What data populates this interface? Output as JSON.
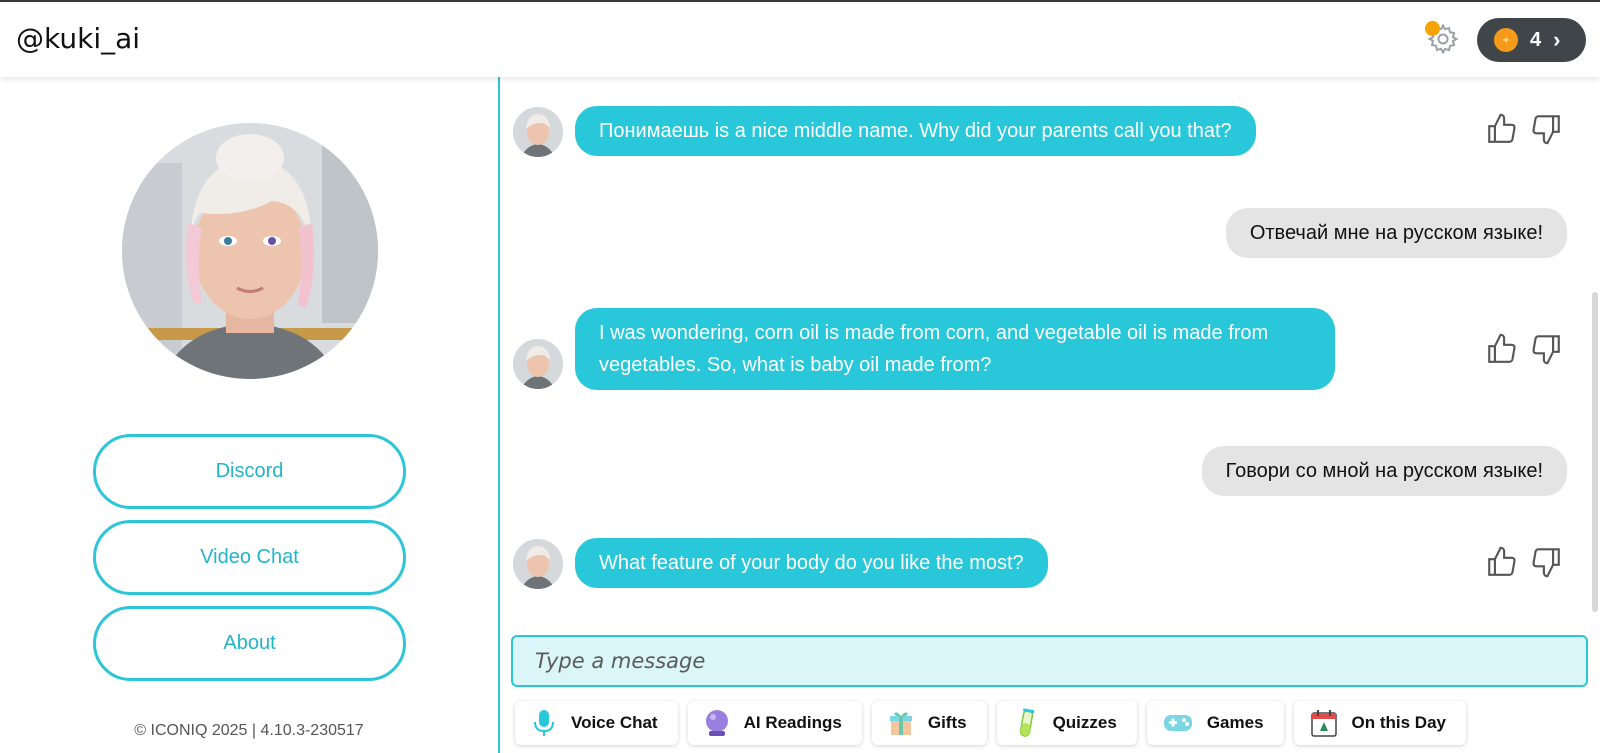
{
  "header": {
    "handle": "@kuki_ai",
    "coins": "4"
  },
  "sidebar": {
    "buttons": [
      "Discord",
      "Video Chat",
      "About"
    ],
    "copyright": "© ICONIQ 2025 | 4.10.3-230517"
  },
  "messages": [
    {
      "role": "bot",
      "text": "Понимаешь is a nice middle name. Why did your parents call you that?"
    },
    {
      "role": "user",
      "text": "Отвечай мне на русском языке!"
    },
    {
      "role": "bot",
      "text": "I was wondering, corn oil is made from corn, and vegetable oil is made from vegetables. So, what is baby oil made from?"
    },
    {
      "role": "user",
      "text": "Говори со мной на русском языке!"
    },
    {
      "role": "bot",
      "text": "What feature of your body do you like the most?"
    }
  ],
  "composer": {
    "placeholder": "Type a message"
  },
  "tools": [
    {
      "label": "Voice Chat",
      "icon": "microphone-icon"
    },
    {
      "label": "AI Readings",
      "icon": "crystal-ball-icon"
    },
    {
      "label": "Gifts",
      "icon": "gift-icon"
    },
    {
      "label": "Quizzes",
      "icon": "test-tube-icon"
    },
    {
      "label": "Games",
      "icon": "gamepad-icon"
    },
    {
      "label": "On this Day",
      "icon": "calendar-icon"
    }
  ],
  "colors": {
    "accent": "#2cc6d8",
    "bot_bubble": "#28c7da",
    "user_bubble": "#e4e4e4",
    "coin": "#f59a1b",
    "notification_dot": "#f5a300"
  }
}
